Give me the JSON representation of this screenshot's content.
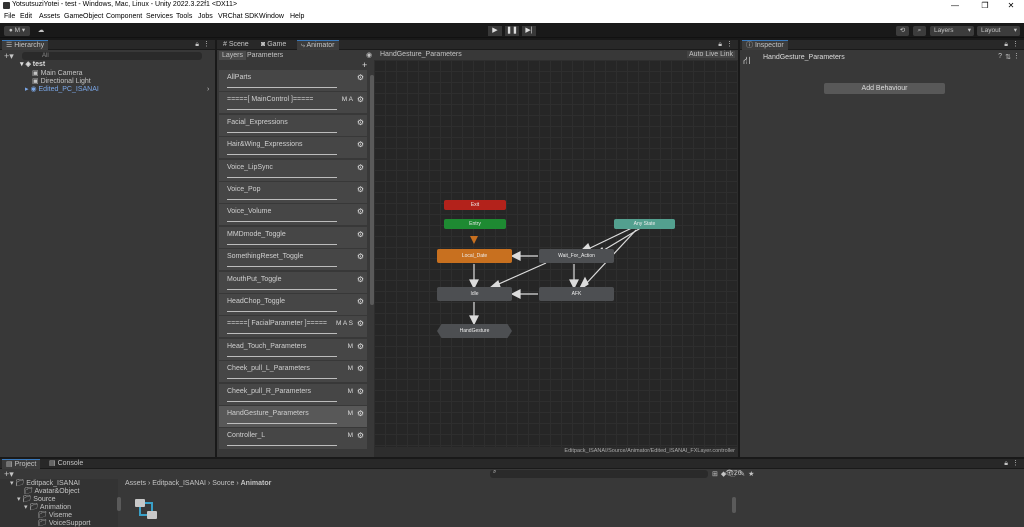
{
  "window": {
    "title": "YotsutsuziYotei - test - Windows, Mac, Linux - Unity 2022.3.22f1 <DX11>"
  },
  "menu": [
    "File",
    "Edit",
    "Assets",
    "GameObject",
    "Component",
    "Services",
    "Tools",
    "Jobs",
    "VRChat SDK",
    "Window",
    "Help"
  ],
  "toolbar": {
    "account": "M",
    "layers": "Layers",
    "layout": "Layout"
  },
  "hierarchy": {
    "tab": "Hierarchy",
    "search_placeholder": "All",
    "scene": "test",
    "objects": [
      "Main Camera",
      "Directional Light",
      "Edited_PC_ISANAI"
    ]
  },
  "center_tabs": [
    "Scene",
    "Game",
    "Animator"
  ],
  "animator": {
    "subtabs": [
      "Layers",
      "Parameters"
    ],
    "breadcrumb": "HandGesture_Parameters",
    "auto_live_link": "Auto Live Link",
    "layers": [
      {
        "name": "AllParts",
        "flags": ""
      },
      {
        "name": "=====[ MainControl ]=====",
        "flags": "M A"
      },
      {
        "name": "Facial_Expressions",
        "flags": ""
      },
      {
        "name": "Hair&Wing_Expressions",
        "flags": ""
      },
      {
        "name": "Voice_LipSync",
        "flags": ""
      },
      {
        "name": "Voice_Pop",
        "flags": ""
      },
      {
        "name": "Voice_Volume",
        "flags": ""
      },
      {
        "name": "MMDmode_Toggle",
        "flags": ""
      },
      {
        "name": "SomethingReset_Toggle",
        "flags": ""
      },
      {
        "name": "MouthPut_Toggle",
        "flags": ""
      },
      {
        "name": "HeadChop_Toggle",
        "flags": ""
      },
      {
        "name": "=====[ FacialParameter ]=====",
        "flags": "M A S"
      },
      {
        "name": "Head_Touch_Parameters",
        "flags": "M"
      },
      {
        "name": "Cheek_pull_L_Parameters",
        "flags": "M"
      },
      {
        "name": "Cheek_pull_R_Parameters",
        "flags": "M"
      },
      {
        "name": "HandGesture_Parameters",
        "flags": "M"
      },
      {
        "name": "Controller_L",
        "flags": "M"
      }
    ],
    "states": {
      "exit": "Exit",
      "entry": "Entry",
      "any": "Any State",
      "local": "Local_Date",
      "wait": "Wait_For_Action",
      "idle": "Idle",
      "afk": "AFK",
      "sub": "HandGesture"
    },
    "status_path": "Editpack_ISANAI/Source/Animator/Edited_ISANAI_FXLayer.controller"
  },
  "inspector": {
    "tab": "Inspector",
    "title": "HandGesture_Parameters",
    "add_behaviour": "Add Behaviour"
  },
  "project": {
    "tabs": [
      "Project",
      "Console"
    ],
    "breadcrumb": [
      "Assets",
      "Editpack_ISANAI",
      "Source",
      "Animator"
    ],
    "tree": [
      "Editpack_ISANAI",
      "Avatar&Object",
      "Source",
      "Animation",
      "Viseme",
      "VoiceSupport"
    ],
    "count": "26"
  },
  "colors": {
    "exit": "#b3221b",
    "entry": "#1e8a32",
    "any": "#53a08f",
    "default": "#c8701f",
    "state": "#4d4f52",
    "accent": "#3a79bb"
  }
}
